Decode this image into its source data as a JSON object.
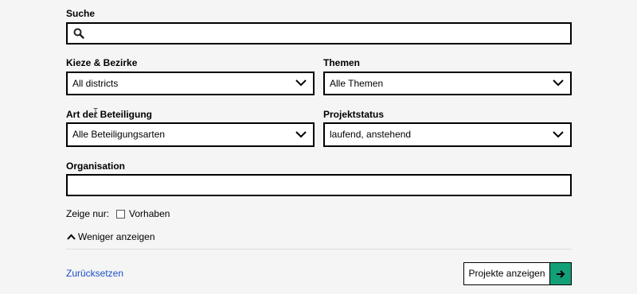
{
  "search": {
    "label": "Suche",
    "value": "",
    "placeholder": ""
  },
  "filters": {
    "district": {
      "label": "Kieze & Bezirke",
      "selected": "All districts"
    },
    "topics": {
      "label": "Themen",
      "selected": "Alle Themen"
    },
    "participation": {
      "label": "Art der Beteiligung",
      "selected": "Alle Beteiligungsarten"
    },
    "status": {
      "label": "Projektstatus",
      "selected": "laufend, anstehend"
    },
    "organisation": {
      "label": "Organisation",
      "value": "",
      "placeholder": ""
    }
  },
  "show_only": {
    "label": "Zeige nur:",
    "option": "Vorhaben",
    "checked": false
  },
  "toggle": {
    "label": "Weniger anzeigen"
  },
  "actions": {
    "reset": "Zurücksetzen",
    "submit": "Projekte anzeigen"
  },
  "colors": {
    "accent": "#13a077",
    "link": "#1a4fc6"
  },
  "icons": {
    "search": "search-icon",
    "chevron": "chevron-down-icon",
    "collapse": "chevron-up-icon",
    "arrow": "arrow-right-icon"
  }
}
